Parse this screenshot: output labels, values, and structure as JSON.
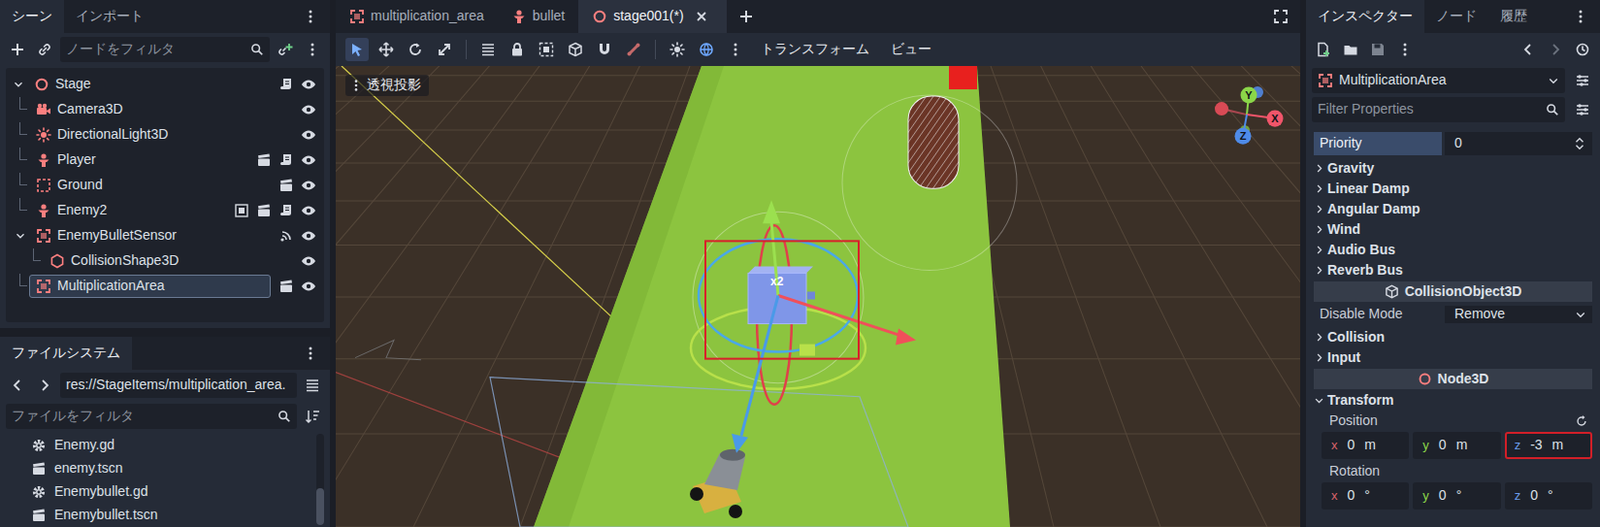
{
  "scene_dock": {
    "tabs": [
      {
        "label": "シーン",
        "selected": true
      },
      {
        "label": "インポート",
        "selected": false
      }
    ],
    "filter": {
      "placeholder": "ノードをフィルタ"
    },
    "tree": [
      {
        "label": "Stage",
        "kind": "root",
        "expanded": true,
        "selected": false,
        "visible": true,
        "in_group": false,
        "instanced": false,
        "has_signals": false,
        "has_script": true,
        "children": [
          {
            "label": "Camera3D",
            "kind": "camera",
            "expanded": false,
            "selected": false,
            "visible": true,
            "in_group": false,
            "instanced": false,
            "has_signals": false,
            "has_script": false,
            "children": []
          },
          {
            "label": "DirectionalLight3D",
            "kind": "light",
            "expanded": false,
            "selected": false,
            "visible": true,
            "in_group": false,
            "instanced": false,
            "has_signals": false,
            "has_script": false,
            "children": []
          },
          {
            "label": "Player",
            "kind": "body",
            "expanded": false,
            "selected": false,
            "visible": true,
            "in_group": false,
            "instanced": true,
            "has_signals": false,
            "has_script": true,
            "children": []
          },
          {
            "label": "Ground",
            "kind": "static",
            "expanded": false,
            "selected": false,
            "visible": true,
            "in_group": false,
            "instanced": true,
            "has_signals": false,
            "has_script": false,
            "children": []
          },
          {
            "label": "Enemy2",
            "kind": "body",
            "expanded": false,
            "selected": false,
            "visible": true,
            "in_group": true,
            "instanced": true,
            "has_signals": false,
            "has_script": true,
            "children": []
          },
          {
            "label": "EnemyBulletSensor",
            "kind": "area",
            "expanded": true,
            "selected": false,
            "visible": true,
            "in_group": false,
            "instanced": false,
            "has_signals": true,
            "has_script": false,
            "children": [
              {
                "label": "CollisionShape3D",
                "kind": "shape",
                "expanded": false,
                "selected": false,
                "visible": true,
                "in_group": false,
                "instanced": false,
                "has_signals": false,
                "has_script": false,
                "children": []
              }
            ]
          },
          {
            "label": "MultiplicationArea",
            "kind": "area",
            "expanded": false,
            "selected": true,
            "visible": true,
            "in_group": false,
            "instanced": true,
            "has_signals": false,
            "has_script": false,
            "children": []
          }
        ]
      }
    ]
  },
  "file_dock": {
    "tabs": [
      {
        "label": "ファイルシステム",
        "selected": true
      }
    ],
    "path": "res://StageItems/multiplication_area.",
    "filter": {
      "placeholder": "ファイルをフィルタ"
    },
    "files": [
      {
        "label": "Enemy.gd",
        "kind": "script"
      },
      {
        "label": "enemy.tscn",
        "kind": "scene"
      },
      {
        "label": "Enemybullet.gd",
        "kind": "script"
      },
      {
        "label": "Enemybullet.tscn",
        "kind": "scene"
      }
    ]
  },
  "editor": {
    "tabs": [
      {
        "label": "multiplication_area",
        "kind": "area",
        "selected": false
      },
      {
        "label": "bullet",
        "kind": "body",
        "selected": false
      },
      {
        "label": "stage001(*)",
        "kind": "root",
        "selected": true
      }
    ],
    "toolbar": {
      "tools": [
        {
          "kind": "select",
          "selected": true
        },
        {
          "kind": "move",
          "selected": false
        },
        {
          "kind": "rotate",
          "selected": false
        },
        {
          "kind": "scale",
          "selected": false
        }
      ],
      "menus": [
        "トランスフォーム",
        "ビュー"
      ]
    },
    "viewport": {
      "projection": "透視投影",
      "selected_label": "x2",
      "annotated": true,
      "axes": [
        {
          "label": "Y",
          "color": "#8bd649"
        },
        {
          "label": "X",
          "color": "#f0556a"
        },
        {
          "label": "Z",
          "color": "#4f8be8"
        }
      ]
    }
  },
  "inspector": {
    "tabs": [
      {
        "label": "インスペクター",
        "selected": true
      },
      {
        "label": "ノード",
        "selected": false
      },
      {
        "label": "履歴",
        "selected": false
      }
    ],
    "node": "MultiplicationArea",
    "filter": {
      "placeholder": "Filter Properties"
    },
    "properties": [
      {
        "kind": "number",
        "label": "Priority",
        "value": "0",
        "highlighted": true
      },
      {
        "kind": "section",
        "label": "Gravity",
        "expanded": false
      },
      {
        "kind": "section",
        "label": "Linear Damp",
        "expanded": false
      },
      {
        "kind": "section",
        "label": "Angular Damp",
        "expanded": false
      },
      {
        "kind": "section",
        "label": "Wind",
        "expanded": false
      },
      {
        "kind": "section",
        "label": "Audio Bus",
        "expanded": false
      },
      {
        "kind": "section",
        "label": "Reverb Bus",
        "expanded": false
      },
      {
        "kind": "category",
        "label": "CollisionObject3D",
        "node_kind": "collision"
      },
      {
        "kind": "enum",
        "label": "Disable Mode",
        "value": "Remove"
      },
      {
        "kind": "section",
        "label": "Collision",
        "expanded": false
      },
      {
        "kind": "section",
        "label": "Input",
        "expanded": false
      },
      {
        "kind": "category",
        "label": "Node3D",
        "node_kind": "root"
      },
      {
        "kind": "section",
        "label": "Transform",
        "expanded": true
      },
      {
        "kind": "vector",
        "label": "Position",
        "resettable": true,
        "fields": [
          {
            "axis": "x",
            "value": "0",
            "unit": "m",
            "color": "#d9636b",
            "annotated": false
          },
          {
            "axis": "y",
            "value": "0",
            "unit": "m",
            "color": "#8bd649",
            "annotated": false
          },
          {
            "axis": "z",
            "value": "-3",
            "unit": "m",
            "color": "#6a9ce8",
            "annotated": true
          }
        ]
      },
      {
        "kind": "vector",
        "label": "Rotation",
        "resettable": false,
        "fields": [
          {
            "axis": "x",
            "value": "0",
            "unit": "°",
            "color": "#d9636b",
            "annotated": false
          },
          {
            "axis": "y",
            "value": "0",
            "unit": "°",
            "color": "#8bd649",
            "annotated": false
          },
          {
            "axis": "z",
            "value": "0",
            "unit": "°",
            "color": "#6a9ce8",
            "annotated": false
          }
        ]
      }
    ]
  }
}
